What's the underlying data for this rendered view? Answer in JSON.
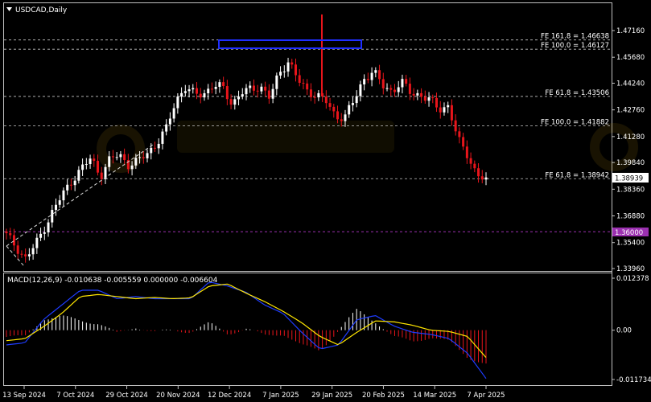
{
  "window": {
    "symbol": "USDCAD,Daily",
    "menu_icon": "triangle-down-icon"
  },
  "colors": {
    "background": "#000000",
    "up": "#ffffff",
    "down": "#e8151b",
    "grid": "#c0c0c0",
    "fib_line": "#c8c8c8",
    "support_line": "#9b30b0",
    "box": "#1f2fff",
    "macd_main": "#1e3cff",
    "macd_signal": "#ffe600",
    "hist_pos": "#ffffff",
    "hist_neg": "#e8151b"
  },
  "price_axis": {
    "ticks": [
      "1.47160",
      "1.45680",
      "1.44240",
      "1.42760",
      "1.41280",
      "1.39840",
      "1.38360",
      "1.36880",
      "1.35400",
      "1.33960"
    ],
    "current_price": "1.38939",
    "support_price": "1.36000"
  },
  "fib_levels": [
    {
      "label": "FE 161.8 = 1.46638",
      "value": 1.46638
    },
    {
      "label": "FE 100.0 = 1.46127",
      "value": 1.46127
    },
    {
      "label": "FE 61.8 = 1.43506",
      "value": 1.43506
    },
    {
      "label": "FE 100.0 = 1.41882",
      "value": 1.41882
    },
    {
      "label": "FE 61.8 = 1.38942",
      "value": 1.38942
    }
  ],
  "macd": {
    "label": "MACD(12,26,9) -0.010638 -0.005559 0.000000 -0.006604",
    "ticks": [
      "0.012378",
      "0.00",
      "-0.011734"
    ]
  },
  "time_axis": [
    "13 Sep 2024",
    "7 Oct 2024",
    "29 Oct 2024",
    "20 Nov 2024",
    "12 Dec 2024",
    "7 Jan 2025",
    "29 Jan 2025",
    "20 Feb 2025",
    "14 Mar 2025",
    "7 Apr 2025"
  ],
  "chart_data": {
    "type": "candlestick",
    "symbol": "USDCAD",
    "timeframe": "Daily",
    "ylim": [
      1.3396,
      1.4776
    ],
    "series": [
      {
        "name": "anchor_closes",
        "values": [
          1.358,
          1.352,
          1.345,
          1.352,
          1.362,
          1.372,
          1.381,
          1.389,
          1.395,
          1.401,
          1.391,
          1.4,
          1.403,
          1.397,
          1.399,
          1.404,
          1.409,
          1.417,
          1.433,
          1.44,
          1.436,
          1.437,
          1.441,
          1.44,
          1.431,
          1.437,
          1.439,
          1.441,
          1.434,
          1.448,
          1.455,
          1.444,
          1.438,
          1.436,
          1.432,
          1.424,
          1.424,
          1.433,
          1.445,
          1.449,
          1.441,
          1.438,
          1.443,
          1.437,
          1.436,
          1.433,
          1.428,
          1.43,
          1.411,
          1.403,
          1.392,
          1.388
        ]
      },
      {
        "name": "macd_main",
        "values": [
          -0.0035,
          -0.003,
          0.0025,
          0.006,
          0.0095,
          0.0095,
          0.0075,
          0.008,
          0.0075,
          0.0075,
          0.0075,
          0.0115,
          0.0105,
          0.009,
          0.006,
          0.004,
          -0.0005,
          -0.0045,
          -0.0035,
          0.0025,
          0.0035,
          0.001,
          -0.0005,
          -0.001,
          -0.002,
          -0.0055,
          -0.0115
        ]
      },
      {
        "name": "macd_signal",
        "values": [
          -0.0025,
          -0.002,
          0.0008,
          0.004,
          0.008,
          0.0085,
          0.008,
          0.0075,
          0.0078,
          0.0075,
          0.0077,
          0.0105,
          0.011,
          0.0088,
          0.0068,
          0.0045,
          0.0018,
          -0.0015,
          -0.0035,
          -0.0005,
          0.0022,
          0.002,
          0.0012,
          0.0,
          -0.0003,
          -0.0015,
          -0.0065
        ]
      }
    ],
    "title": "USDCAD,Daily"
  }
}
